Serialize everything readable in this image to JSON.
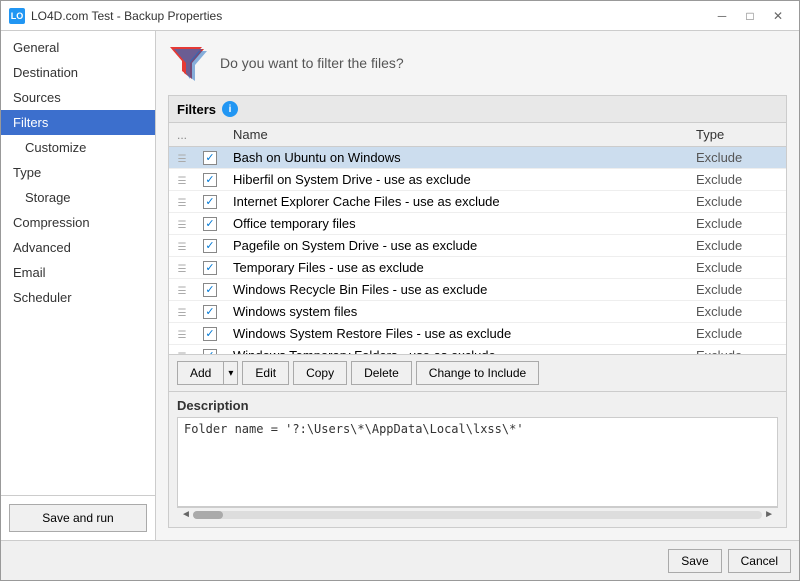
{
  "window": {
    "title": "LO4D.com Test - Backup Properties",
    "icon": "LO"
  },
  "sidebar": {
    "items": [
      {
        "label": "General",
        "id": "general",
        "active": false,
        "sub": false
      },
      {
        "label": "Destination",
        "id": "destination",
        "active": false,
        "sub": false
      },
      {
        "label": "Sources",
        "id": "sources",
        "active": false,
        "sub": false
      },
      {
        "label": "Filters",
        "id": "filters",
        "active": true,
        "sub": false
      },
      {
        "label": "Customize",
        "id": "customize",
        "active": false,
        "sub": true
      },
      {
        "label": "Type",
        "id": "type",
        "active": false,
        "sub": false
      },
      {
        "label": "Storage",
        "id": "storage",
        "active": false,
        "sub": true
      },
      {
        "label": "Compression",
        "id": "compression",
        "active": false,
        "sub": false
      },
      {
        "label": "Advanced",
        "id": "advanced",
        "active": false,
        "sub": false
      },
      {
        "label": "Email",
        "id": "email",
        "active": false,
        "sub": false
      },
      {
        "label": "Scheduler",
        "id": "scheduler",
        "active": false,
        "sub": false
      }
    ],
    "save_run_label": "Save and run"
  },
  "header": {
    "question": "Do you want to filter the files?"
  },
  "filters_panel": {
    "title": "Filters",
    "columns": [
      "...",
      "Name",
      "Type"
    ],
    "rows": [
      {
        "checked": true,
        "name": "Bash on Ubuntu on Windows",
        "type": "Exclude"
      },
      {
        "checked": true,
        "name": "Hiberfil on System Drive - use as exclude",
        "type": "Exclude"
      },
      {
        "checked": true,
        "name": "Internet Explorer Cache Files - use as exclude",
        "type": "Exclude"
      },
      {
        "checked": true,
        "name": "Office temporary files",
        "type": "Exclude"
      },
      {
        "checked": true,
        "name": "Pagefile on System Drive - use as exclude",
        "type": "Exclude"
      },
      {
        "checked": true,
        "name": "Temporary Files - use as exclude",
        "type": "Exclude"
      },
      {
        "checked": true,
        "name": "Windows Recycle Bin Files - use as exclude",
        "type": "Exclude"
      },
      {
        "checked": true,
        "name": "Windows system files",
        "type": "Exclude"
      },
      {
        "checked": true,
        "name": "Windows System Restore Files - use as exclude",
        "type": "Exclude"
      },
      {
        "checked": true,
        "name": "Windows Temporary Folders - use as exclude",
        "type": "Exclude"
      }
    ]
  },
  "buttons": {
    "add": "Add",
    "edit": "Edit",
    "copy": "Copy",
    "delete": "Delete",
    "change_to_include": "Change to Include"
  },
  "description": {
    "label": "Description",
    "text": "Folder name = '?:\\Users\\*\\AppData\\Local\\lxss\\*'"
  },
  "window_buttons": {
    "save": "Save",
    "cancel": "Cancel"
  },
  "titlebar_controls": {
    "minimize": "─",
    "maximize": "□",
    "close": "✕"
  }
}
